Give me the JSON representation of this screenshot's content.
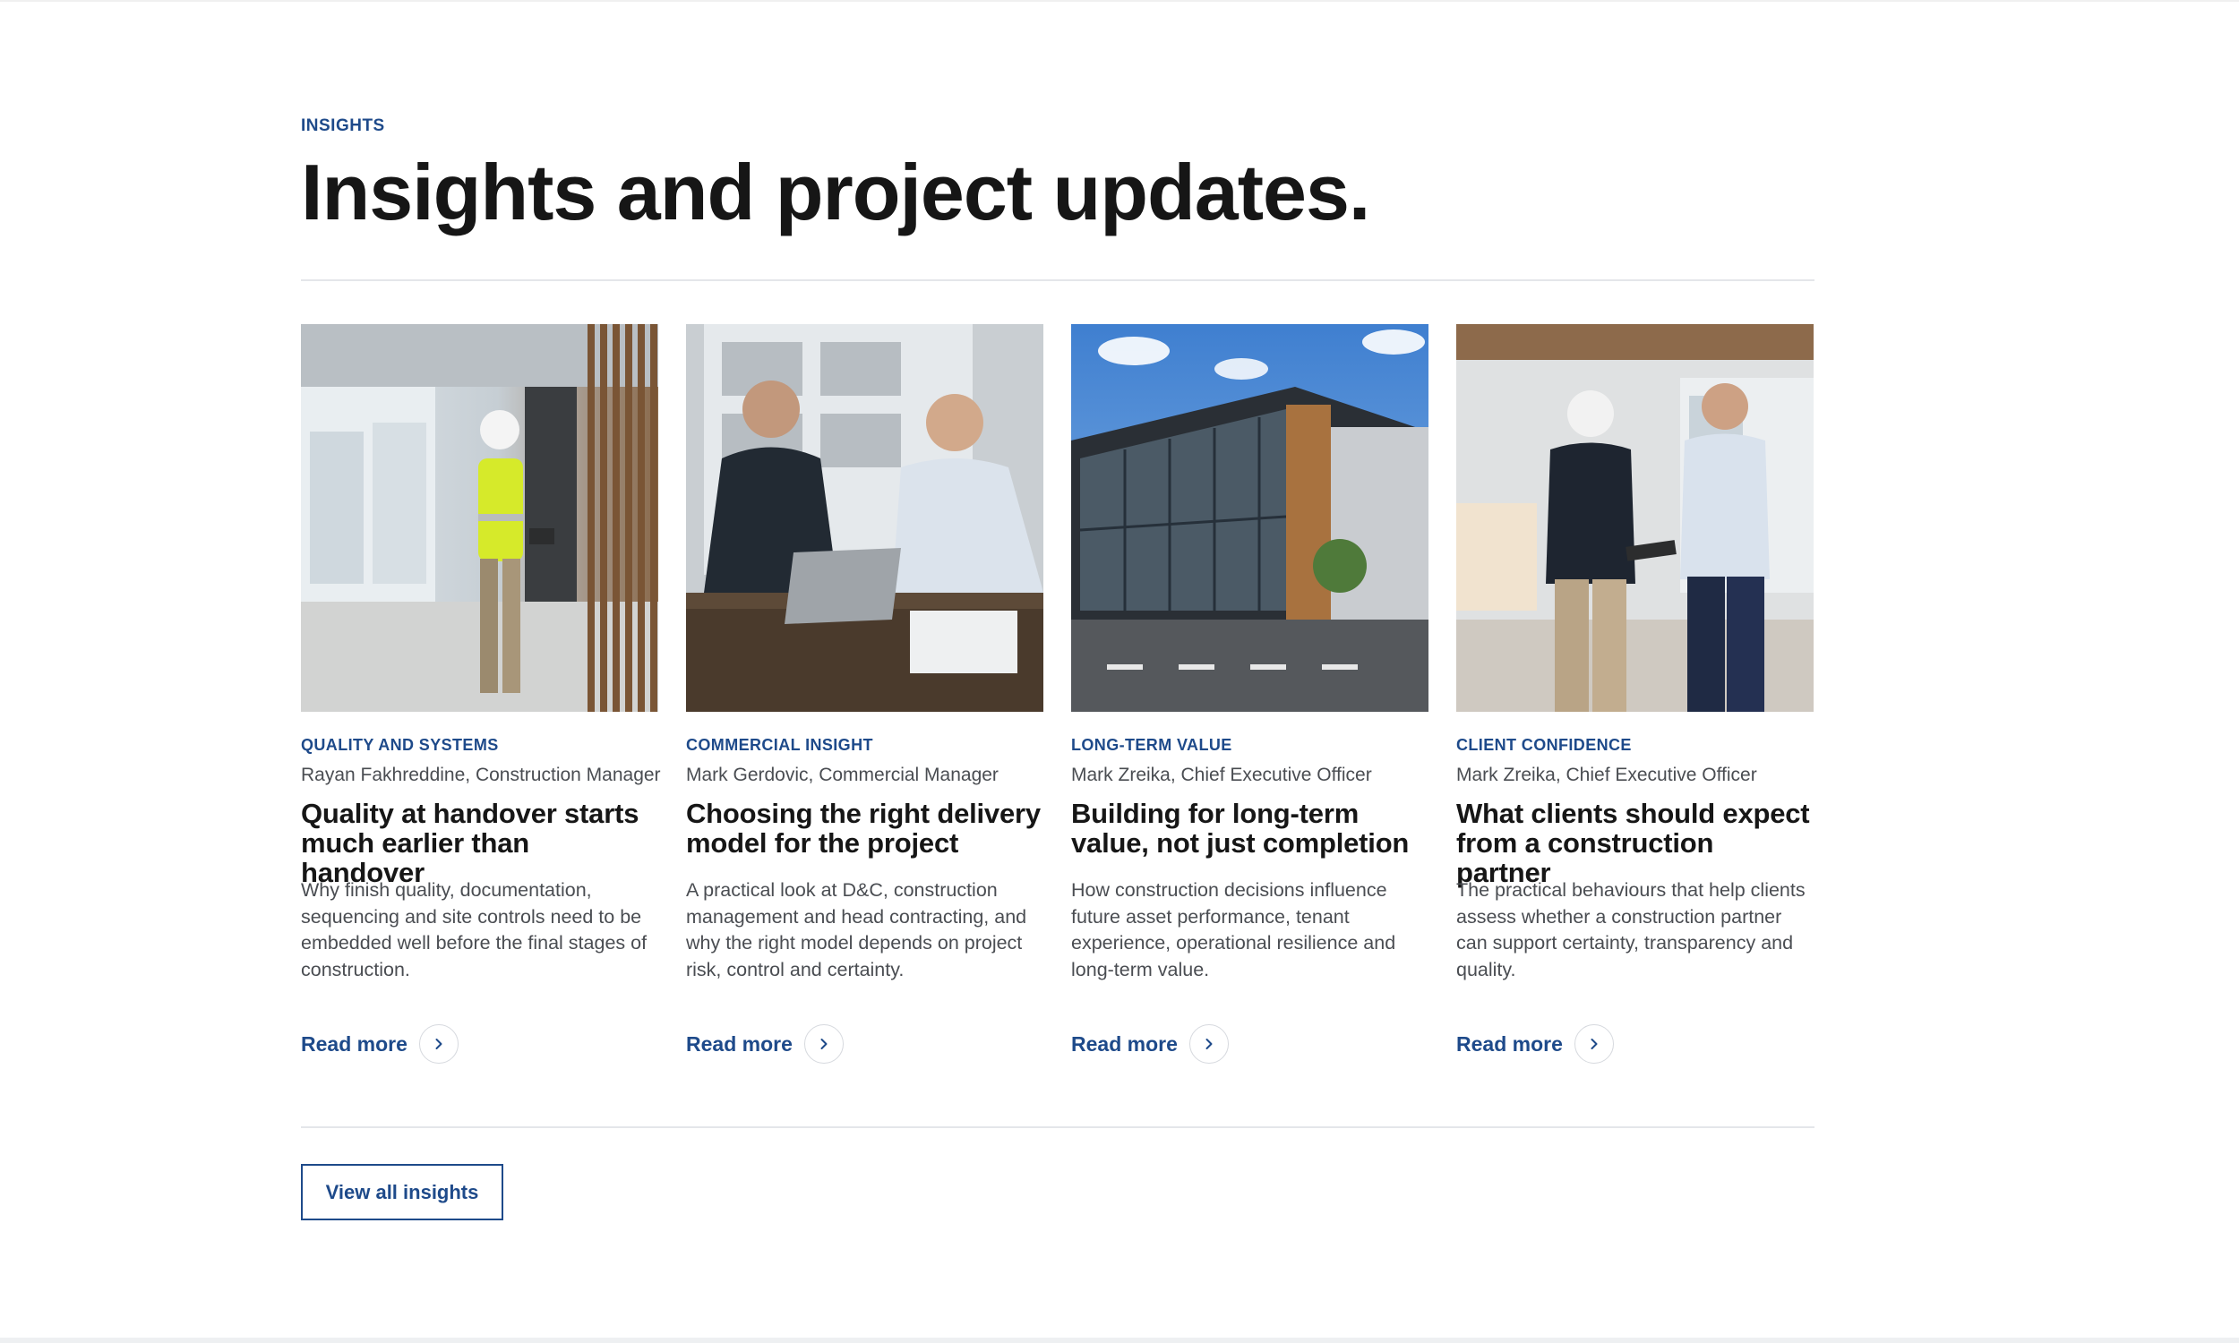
{
  "section": {
    "eyebrow": "INSIGHTS",
    "heading": "Insights and project updates.",
    "view_all_label": "View all insights"
  },
  "colors": {
    "accent": "#1e4a8a",
    "heading": "#161616",
    "body_text": "#4a4d52",
    "divider": "#e4e6ea"
  },
  "cards": [
    {
      "image_icon": "photo-site-inspection",
      "category": "QUALITY AND SYSTEMS",
      "author": "Rayan Fakhreddine, Construction Manager",
      "title": "Quality at handover starts much earlier than handover",
      "description": "Why finish quality, documentation, sequencing and site controls need to be embedded well before the final stages of construction.",
      "read_more": "Read more",
      "arrow_icon": "chevron-right-icon"
    },
    {
      "image_icon": "photo-office-meeting",
      "category": "COMMERCIAL INSIGHT",
      "author": "Mark Gerdovic, Commercial Manager",
      "title": "Choosing the right delivery model for the project",
      "description": "A practical look at D&C, construction management and head contracting, and why the right model depends on project risk, control and certainty.",
      "read_more": "Read more",
      "arrow_icon": "chevron-right-icon"
    },
    {
      "image_icon": "photo-modern-building",
      "category": "LONG-TERM VALUE",
      "author": "Mark Zreika, Chief Executive Officer",
      "title": "Building for long-term value, not just completion",
      "description": "How construction decisions influence future asset performance, tenant experience, operational resilience and long-term value.",
      "read_more": "Read more",
      "arrow_icon": "chevron-right-icon"
    },
    {
      "image_icon": "photo-walkthrough",
      "category": "CLIENT CONFIDENCE",
      "author": "Mark Zreika, Chief Executive Officer",
      "title": "What clients should expect from a construction partner",
      "description": "The practical behaviours that help clients assess whether a construction partner can support certainty, transparency and quality.",
      "read_more": "Read more",
      "arrow_icon": "chevron-right-icon"
    }
  ]
}
